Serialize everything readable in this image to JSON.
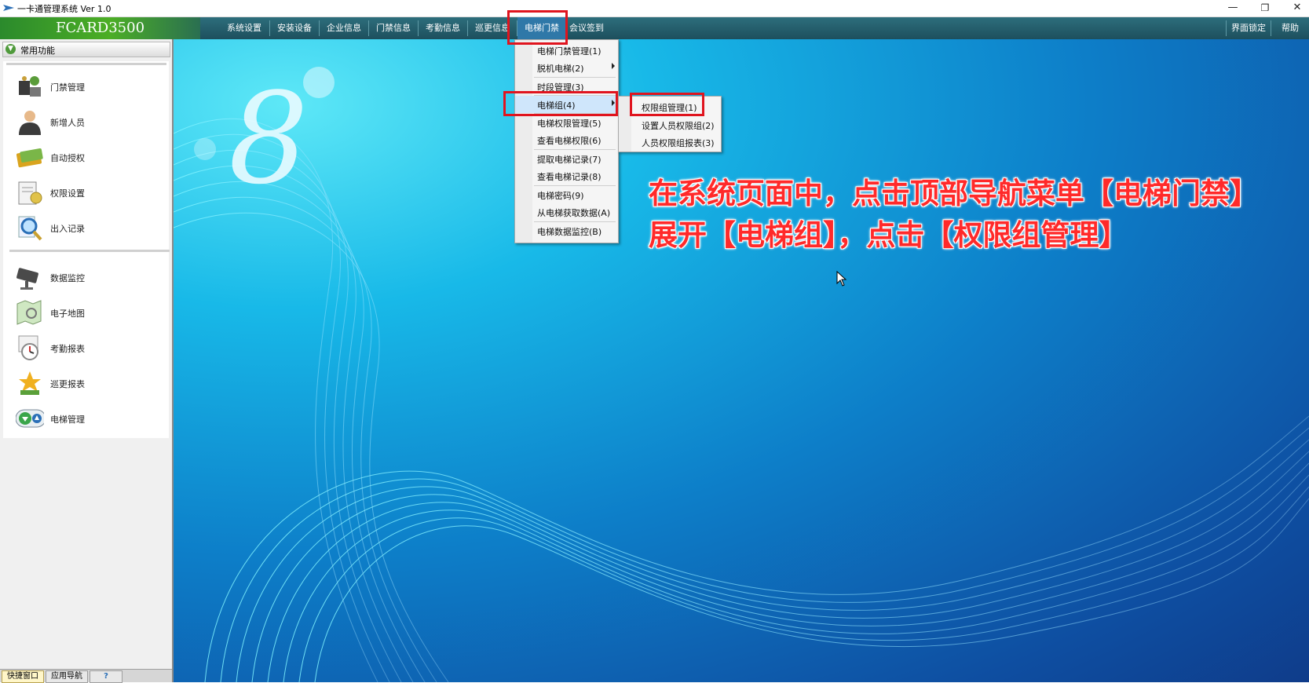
{
  "window": {
    "title": "一卡通管理系统  Ver 1.0",
    "minimize": "—",
    "restore": "❐",
    "close": "✕"
  },
  "navbar": {
    "brand": "FCARD3500",
    "menus": [
      "系统设置",
      "安装设备",
      "企业信息",
      "门禁信息",
      "考勤信息",
      "巡更信息",
      "电梯门禁",
      "会议签到"
    ],
    "right_menus": [
      "界面锁定",
      "帮助"
    ]
  },
  "left_panel": {
    "header": "常用功能",
    "items_group1": [
      "门禁管理",
      "新增人员",
      "自动授权",
      "权限设置",
      "出入记录"
    ],
    "items_group2": [
      "数据监控",
      "电子地图",
      "考勤报表",
      "巡更报表",
      "电梯管理"
    ],
    "bottom_tabs": [
      "快捷窗口",
      "应用导航",
      "?"
    ]
  },
  "dropdown": {
    "items": [
      "电梯门禁管理(1)",
      "脱机电梯(2)",
      "时段管理(3)",
      "电梯组(4)",
      "电梯权限管理(5)",
      "查看电梯权限(6)",
      "提取电梯记录(7)",
      "查看电梯记录(8)",
      "电梯密码(9)",
      "从电梯获取数据(A)",
      "电梯数据监控(B)"
    ]
  },
  "submenu": {
    "items": [
      "权限组管理(1)",
      "设置人员权限组(2)",
      "人员权限组报表(3)"
    ]
  },
  "annotation": {
    "line1": "在系统页面中，点击顶部导航菜单【电梯门禁】",
    "line2": "展开【电梯组】，点击【权限组管理】"
  },
  "colors": {
    "highlight": "#e0141e",
    "annotation_text": "#ff2a2a",
    "brand_green": "#4cae25",
    "nav_bg": "#1d4f5d"
  }
}
